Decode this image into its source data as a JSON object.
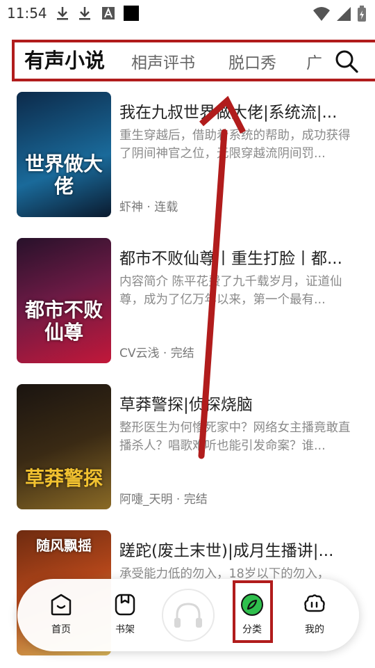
{
  "status_bar": {
    "time": "11:54",
    "icons": [
      "download-icon",
      "download-icon",
      "a-icon",
      "black-square-icon",
      "wifi-icon",
      "signal-icon",
      "battery-icon"
    ]
  },
  "tabs": [
    {
      "label": "有声小说",
      "active": true
    },
    {
      "label": "相声评书",
      "active": false
    },
    {
      "label": "脱口秀",
      "active": false
    },
    {
      "label": "广",
      "active": false
    }
  ],
  "books": [
    {
      "title": "我在九叔世界做大佬|系统流|...",
      "description": "重生穿越后，借助着系统的帮助，成功获得了阴间神官之位，无限穿越流阴间罚...",
      "author": "虾神",
      "status": "连载",
      "cover_text": "世界做大佬",
      "cover_colors": [
        "#0c2a4a",
        "#1a6a9a"
      ]
    },
    {
      "title": "都市不败仙尊丨重生打脸丨都...",
      "description": "内容简介 陈平花费了九千载岁月，证道仙尊，成为了亿万年以来，第一个最有...",
      "author": "CV云浅",
      "status": "完结",
      "cover_text": "都市不败仙尊",
      "cover_colors": [
        "#27112a",
        "#c2183a"
      ]
    },
    {
      "title": "草莽警探|侦探烧脑",
      "description": "整形医生为何惨死家中？网络女主播竟敢直播杀人？唱歌难听也能引发命案？谁...",
      "author": "阿嚏_天明",
      "status": "完结",
      "cover_text": "草莽警探",
      "cover_colors": [
        "#1a1410",
        "#8a6a26"
      ]
    },
    {
      "title": "蹉跎(废土末世)|成月生播讲|...",
      "description": "承受能力低的勿入，18岁以下的勿入，",
      "author": "",
      "status": "",
      "cover_text": "随风飘摇",
      "cover_colors": [
        "#6e2b10",
        "#d7b45a"
      ]
    }
  ],
  "nav": [
    {
      "label": "首页",
      "icon": "home-icon"
    },
    {
      "label": "书架",
      "icon": "bookshelf-icon"
    },
    {
      "label": "",
      "icon": "headphones-icon"
    },
    {
      "label": "分类",
      "icon": "category-icon",
      "accent": "#2fbf4d"
    },
    {
      "label": "我的",
      "icon": "profile-icon"
    }
  ],
  "accent_colors": {
    "annotation": "#b11c1c",
    "category": "#2fbf4d"
  }
}
